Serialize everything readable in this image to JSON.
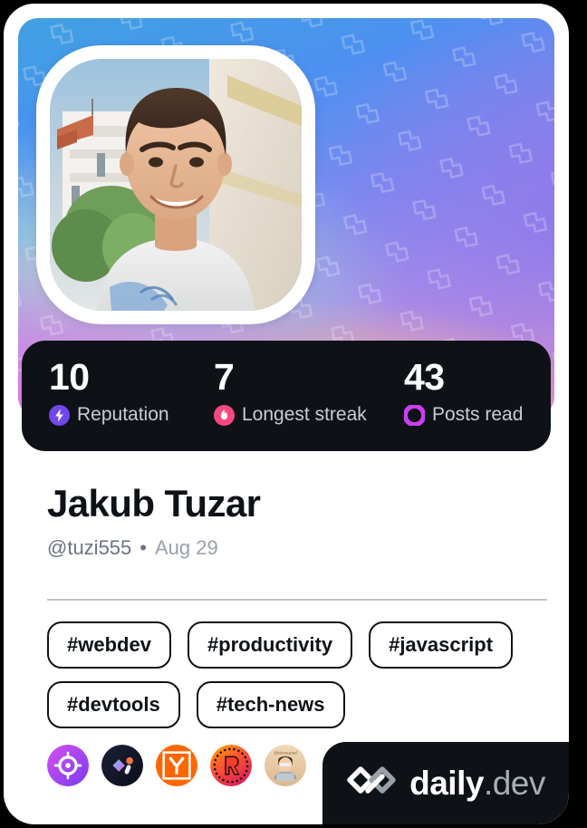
{
  "card": {
    "background_color": "#ffffff",
    "cover_gradient_colors": [
      "#3fa1e1",
      "#4d90f1",
      "#7f89ef",
      "#a98ce9",
      "#cf8fd8",
      "#ef79cd",
      "#fbc083",
      "#a9ddd4"
    ],
    "dark_color": "#0e1217"
  },
  "avatar": {
    "name": "user-avatar-photo",
    "alt": "Portrait photo of a smiling man in a white t-shirt outdoors"
  },
  "stats": [
    {
      "value": "10",
      "label": "Reputation",
      "icon": "reputation-bolt-icon",
      "icon_color": "#7147ED"
    },
    {
      "value": "7",
      "label": "Longest streak",
      "icon": "streak-flame-icon",
      "icon_color": "#F5487F"
    },
    {
      "value": "43",
      "label": "Posts read",
      "icon": "posts-read-ring-icon",
      "icon_color": "#CE3DF3"
    }
  ],
  "profile": {
    "display_name": "Jakub Tuzar",
    "handle": "@tuzi555",
    "separator": "•",
    "joined": "Aug 29"
  },
  "tags": [
    "#webdev",
    "#productivity",
    "#javascript",
    "#devtools",
    "#tech-news"
  ],
  "sources": [
    {
      "name": "source-badge-target",
      "title": "target"
    },
    {
      "name": "source-badge-dark",
      "title": "dark"
    },
    {
      "name": "source-badge-hacker-news",
      "title": "Y"
    },
    {
      "name": "source-badge-r",
      "title": "R"
    },
    {
      "name": "source-badge-avatar",
      "title": "devsquad"
    }
  ],
  "branding": {
    "logo_icon": "daily-dev-logo-icon",
    "name_primary": "daily",
    "name_suffix": ".dev"
  }
}
